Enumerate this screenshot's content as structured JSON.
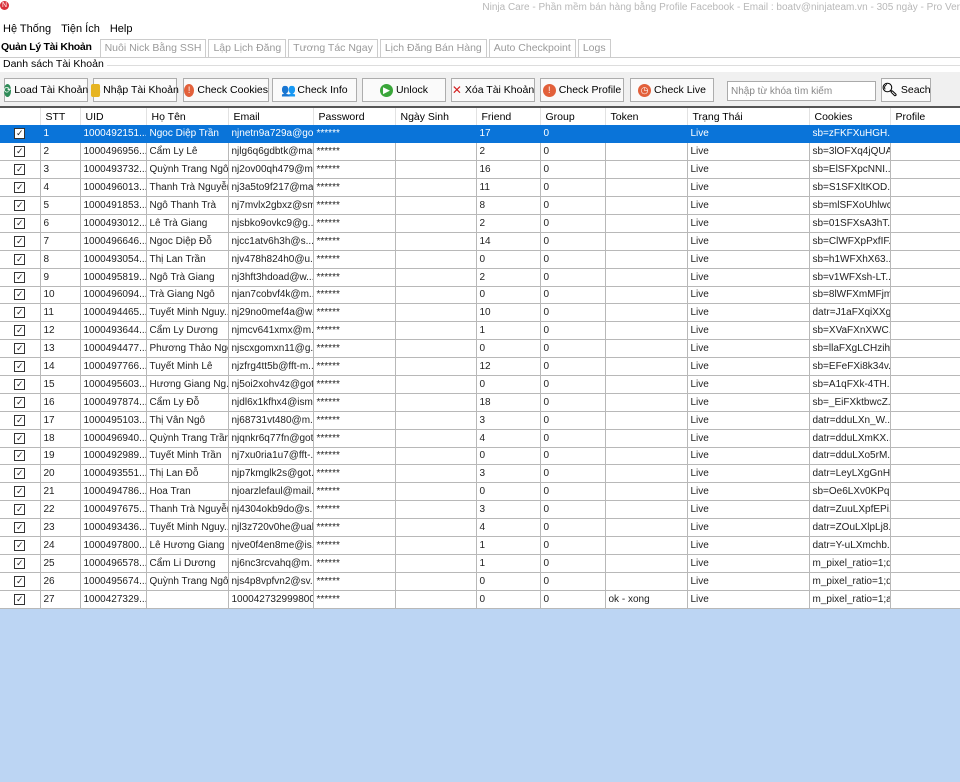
{
  "window": {
    "title": "Ninja Care - Phần mềm bán hàng bằng Profile Facebook - Email : boatv@ninjateam.vn - 305 ngày - Pro Ver",
    "icon": "ninja-logo-icon"
  },
  "menu": [
    "Hệ Thống",
    "Tiện Ích",
    "Help"
  ],
  "tabs": [
    "Quản Lý Tài Khoản",
    "Nuôi Nick Bằng SSH",
    "Lập Lịch Đăng",
    "Tương Tác Ngay",
    "Lịch Đăng Bán Hàng",
    "Auto Checkpoint",
    "Logs"
  ],
  "group_label": "Danh sách Tài Khoản",
  "toolbar": {
    "buttons": [
      {
        "label": "Load Tài Khoản",
        "icon": "refresh-icon",
        "color": "#2e8b57"
      },
      {
        "label": "Nhập Tài Khoản",
        "icon": "folder-icon",
        "color": "#e6b422"
      },
      {
        "label": "Check Cookies",
        "icon": "alert-icon",
        "color": "#e2603a"
      },
      {
        "label": "Check Info",
        "icon": "users-icon",
        "color": "#d9532a"
      },
      {
        "label": "Unlock",
        "icon": "play-icon",
        "color": "#3aa63a"
      },
      {
        "label": "Xóa Tài Khoản",
        "icon": "x-icon",
        "color": "#d32020"
      },
      {
        "label": "Check Profile",
        "icon": "alert-icon",
        "color": "#e2603a"
      },
      {
        "label": "Check Live",
        "icon": "clock-icon",
        "color": "#e2603a"
      }
    ],
    "search_placeholder": "Nhập từ khóa tìm kiếm",
    "search_label": "Seach"
  },
  "accent": "#0a74d9",
  "table": {
    "columns": [
      "",
      "STT",
      "UID",
      "Họ Tên",
      "Email",
      "Password",
      "Ngày Sinh",
      "Friend",
      "Group",
      "Token",
      "Trạng Thái",
      "Cookies",
      "Profile"
    ],
    "selected_row": 1,
    "rows": [
      [
        "1",
        "1000492151...",
        "Ngoc Diệp Trần",
        "njnetn9a729a@go...",
        "******",
        "",
        "17",
        "0",
        "",
        "Live",
        "sb=zFKFXuHGH..."
      ],
      [
        "2",
        "1000496956...",
        "Cẩm Ly Lê",
        "njlg6q6gdbtk@mai...",
        "******",
        "",
        "2",
        "0",
        "",
        "Live",
        "sb=3lOFXq4jQUA..."
      ],
      [
        "3",
        "1000493732...",
        "Quỳnh Trang Ngô",
        "nj2ov00qh479@m...",
        "******",
        "",
        "16",
        "0",
        "",
        "Live",
        "sb=ElSFXpcNNI..."
      ],
      [
        "4",
        "1000496013...",
        "Thanh Trà Nguyễn",
        "nj3a5to9f217@ma...",
        "******",
        "",
        "11",
        "0",
        "",
        "Live",
        "sb=S1SFXltKOD..."
      ],
      [
        "5",
        "1000491853...",
        "Ngô Thanh Trà",
        "nj7mvlx2gbxz@sm...",
        "******",
        "",
        "8",
        "0",
        "",
        "Live",
        "sb=mlSFXoUhlwc..."
      ],
      [
        "6",
        "1000493012...",
        "Lê Trà Giang",
        "njsbko9ovkc9@g...",
        "******",
        "",
        "2",
        "0",
        "",
        "Live",
        "sb=01SFXsA3hT..."
      ],
      [
        "7",
        "1000496646...",
        "Ngoc Diệp Đỗ",
        "njcc1atv6h3h@s...",
        "******",
        "",
        "14",
        "0",
        "",
        "Live",
        "sb=ClWFXpPxfIF..."
      ],
      [
        "8",
        "1000493054...",
        "Thị Lan Trần",
        "njv478h824h0@u...",
        "******",
        "",
        "0",
        "0",
        "",
        "Live",
        "sb=h1WFXhX63..."
      ],
      [
        "9",
        "1000495819...",
        "Ngô Trà Giang",
        "nj3hft3hdoad@w...",
        "******",
        "",
        "2",
        "0",
        "",
        "Live",
        "sb=v1WFXsh-LT..."
      ],
      [
        "10",
        "1000496094...",
        "Trà Giang Ngô",
        "njan7cobvf4k@m...",
        "******",
        "",
        "0",
        "0",
        "",
        "Live",
        "sb=8lWFXmMFjm..."
      ],
      [
        "11",
        "1000494465...",
        "Tuyết Minh Nguy...",
        "nj29no0mef4a@w...",
        "******",
        "",
        "10",
        "0",
        "",
        "Live",
        "datr=J1aFXqiXXg..."
      ],
      [
        "12",
        "1000493644...",
        "Cẩm Ly Dương",
        "njmcv641xmx@m...",
        "******",
        "",
        "1",
        "0",
        "",
        "Live",
        "sb=XVaFXnXWC..."
      ],
      [
        "13",
        "1000494477...",
        "Phương Thảo Ngô",
        "njscxgomxn11@g...",
        "******",
        "",
        "0",
        "0",
        "",
        "Live",
        "sb=llaFXgLCHzih..."
      ],
      [
        "14",
        "1000497766...",
        "Tuyết Minh Lê",
        "njzfrg4tt5b@fft-m...",
        "******",
        "",
        "12",
        "0",
        "",
        "Live",
        "sb=EFeFXi8k34v..."
      ],
      [
        "15",
        "1000495603...",
        "Hương Giang Ng...",
        "nj5oi2xohv4z@got...",
        "******",
        "",
        "0",
        "0",
        "",
        "Live",
        "sb=A1qFXk-4TH..."
      ],
      [
        "16",
        "1000497874...",
        "Cẩm Ly Đỗ",
        "njdl6x1kfhx4@ism...",
        "******",
        "",
        "18",
        "0",
        "",
        "Live",
        "sb=_EiFXktbwcZ..."
      ],
      [
        "17",
        "1000495103...",
        "Thị Vân Ngô",
        "nj68731vt480@m...",
        "******",
        "",
        "3",
        "0",
        "",
        "Live",
        "datr=dduLXn_W..."
      ],
      [
        "18",
        "1000496940...",
        "Quỳnh Trang Trần",
        "njqnkr6q77fn@got...",
        "******",
        "",
        "4",
        "0",
        "",
        "Live",
        "datr=dduLXmKX..."
      ],
      [
        "19",
        "1000492989...",
        "Tuyết Minh Trần",
        "nj7xu0ria1u7@fft-...",
        "******",
        "",
        "0",
        "0",
        "",
        "Live",
        "datr=dduLXo5rM..."
      ],
      [
        "20",
        "1000493551...",
        "Thị Lan Đỗ",
        "njp7kmglk2s@got...",
        "******",
        "",
        "3",
        "0",
        "",
        "Live",
        "datr=LeyLXgGnH..."
      ],
      [
        "21",
        "1000494786...",
        "Hoa Tran",
        "njoarzlefaul@mail...",
        "******",
        "",
        "0",
        "0",
        "",
        "Live",
        "sb=Oe6LXv0KPq..."
      ],
      [
        "22",
        "1000497675...",
        "Thanh Trà Nguyễn",
        "nj4304okb9do@s...",
        "******",
        "",
        "3",
        "0",
        "",
        "Live",
        "datr=ZuuLXpfEPi..."
      ],
      [
        "23",
        "1000493436...",
        "Tuyết Minh Nguy...",
        "njl3z720v0he@ual...",
        "******",
        "",
        "4",
        "0",
        "",
        "Live",
        "datr=ZOuLXlpLj8..."
      ],
      [
        "24",
        "1000497800...",
        "Lê Hương Giang",
        "njve0f4en8me@is...",
        "******",
        "",
        "1",
        "0",
        "",
        "Live",
        "datr=Y-uLXmchb..."
      ],
      [
        "25",
        "1000496578...",
        "Cẩm Li Dương",
        "nj6nc3rcvahq@m...",
        "******",
        "",
        "1",
        "0",
        "",
        "Live",
        "m_pixel_ratio=1;d..."
      ],
      [
        "26",
        "1000495674...",
        "Quỳnh Trang Ngô",
        "njs4p8vpfvn2@sv...",
        "******",
        "",
        "0",
        "0",
        "",
        "Live",
        "m_pixel_ratio=1;d..."
      ],
      [
        "27",
        "1000427329...",
        "",
        "100042732999800",
        "******",
        "",
        "0",
        "0",
        "ok - xong",
        "Live",
        "m_pixel_ratio=1;a..."
      ]
    ]
  }
}
